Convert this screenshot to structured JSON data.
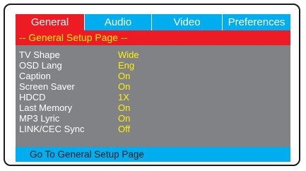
{
  "tabs": [
    {
      "label": "General",
      "active": true
    },
    {
      "label": "Audio",
      "active": false
    },
    {
      "label": "Video",
      "active": false
    },
    {
      "label": "Preferences",
      "active": false
    }
  ],
  "page_title": "-- General Setup Page --",
  "settings": [
    {
      "label": "TV Shape",
      "value": "Wide"
    },
    {
      "label": "OSD Lang",
      "value": "Eng"
    },
    {
      "label": "Caption",
      "value": "On"
    },
    {
      "label": "Screen Saver",
      "value": "On"
    },
    {
      "label": "HDCD",
      "value": "1X"
    },
    {
      "label": "Last Memory",
      "value": "On"
    },
    {
      "label": "MP3 Lyric",
      "value": "On"
    },
    {
      "label": "LINK/CEC Sync",
      "value": "Off"
    }
  ],
  "status_text": "Go To General Setup Page",
  "colors": {
    "active_tab": "#ed1c24",
    "tab_bar": "#00aeef",
    "menu_background": "#808285",
    "value_text": "#fff200",
    "label_text": "#ffffff"
  }
}
